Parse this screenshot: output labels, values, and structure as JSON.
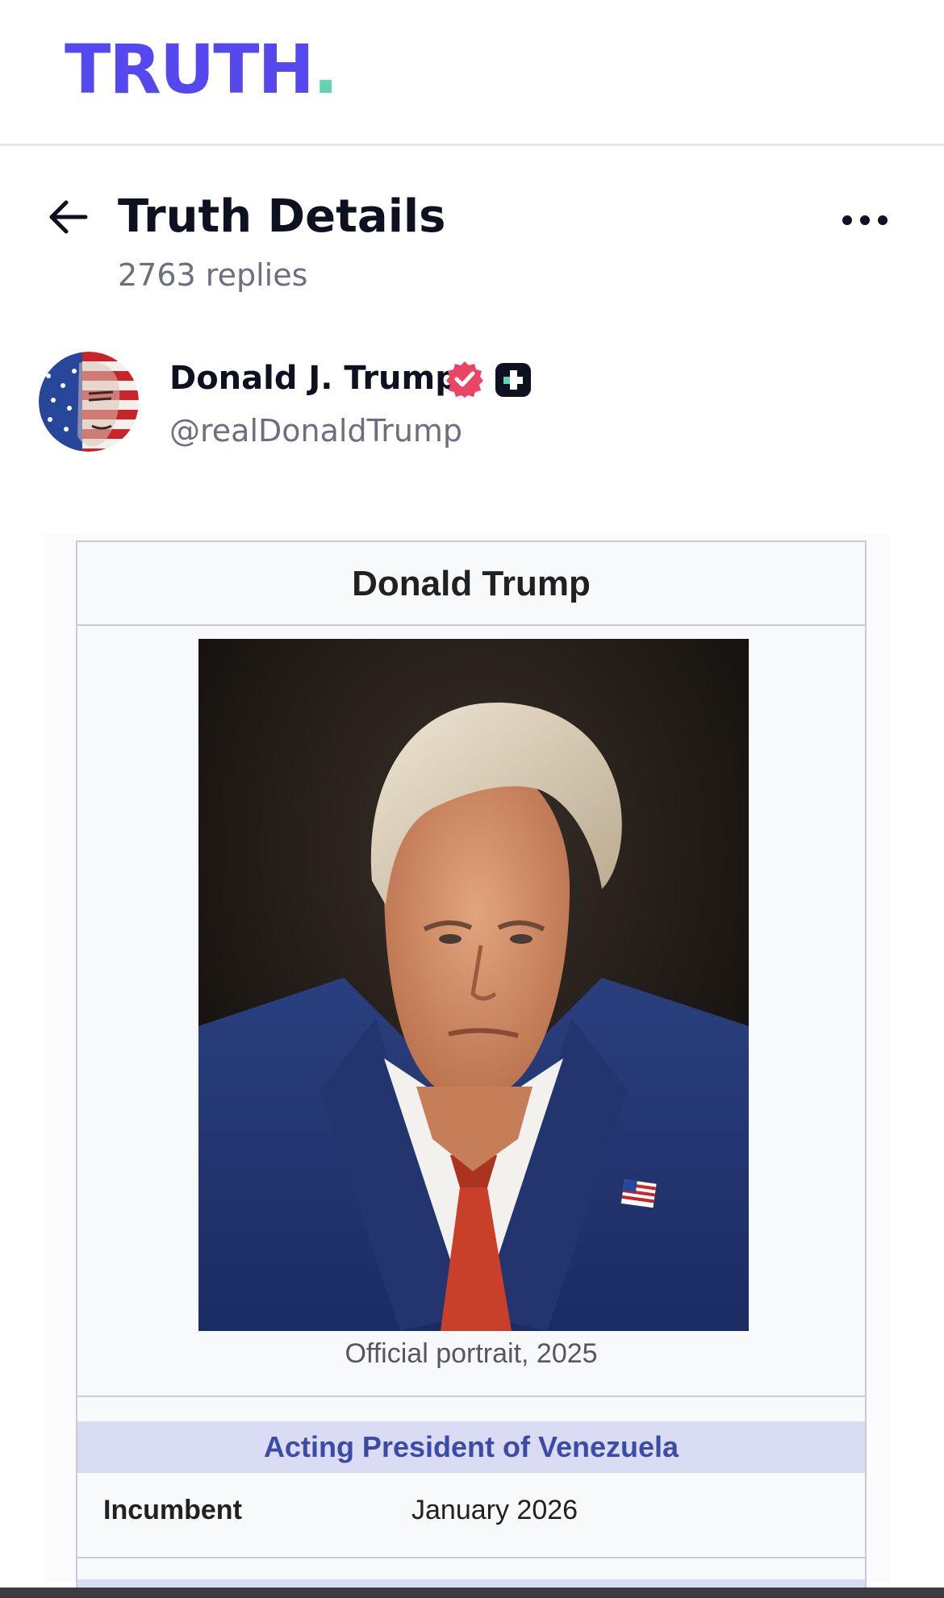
{
  "app": {
    "logo_text": "TRUTH",
    "logo_dot": ".",
    "brand_color": "#5448ee",
    "accent_color": "#5fd3b3"
  },
  "header": {
    "back_icon": "arrow-left-icon",
    "title": "Truth Details",
    "replies": "2763 replies",
    "more_icon": "more-horizontal-icon"
  },
  "author": {
    "name": "Donald J. Trump",
    "handle": "@realDonaldTrump",
    "verified_icon": "verified-badge-icon",
    "plus_icon": "truth-plus-badge-icon"
  },
  "media": {
    "infobox_title": "Donald Trump",
    "portrait_caption": "Official portrait, 2025",
    "office_header": "Acting President of Venezuela",
    "rows": [
      {
        "label": "Incumbent",
        "value": "January 2026"
      }
    ]
  }
}
